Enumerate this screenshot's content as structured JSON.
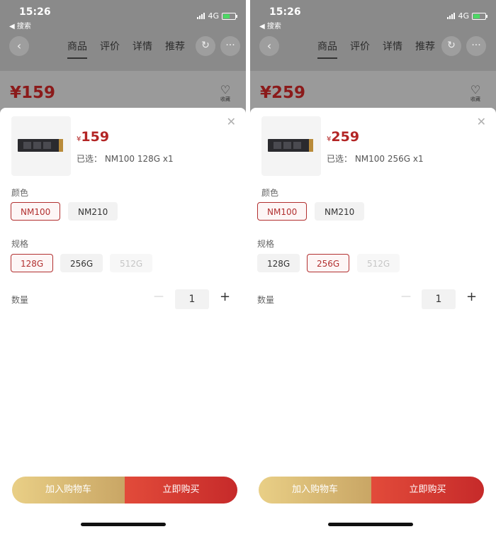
{
  "screens": [
    {
      "status": {
        "time": "15:26",
        "back_label": "◀ 搜索",
        "network": "4G"
      },
      "nav": {
        "back_icon": "chevron-left-icon",
        "tabs": [
          {
            "label": "商品"
          },
          {
            "label": "评价"
          },
          {
            "label": "详情"
          },
          {
            "label": "推荐"
          }
        ]
      },
      "background": {
        "price": "¥159",
        "favorite_label": "收藏"
      },
      "sheet": {
        "currency": "¥",
        "price": "159",
        "selected_text": "已选： NM100 128G x1",
        "color": {
          "label": "颜色",
          "options": [
            {
              "label": "NM100",
              "state": "selected"
            },
            {
              "label": "NM210",
              "state": "normal"
            }
          ]
        },
        "spec": {
          "label": "规格",
          "options": [
            {
              "label": "128G",
              "state": "selected"
            },
            {
              "label": "256G",
              "state": "normal"
            },
            {
              "label": "512G",
              "state": "disabled"
            }
          ]
        },
        "quantity": {
          "label": "数量",
          "minus": "—",
          "value": "1",
          "plus": "+"
        },
        "add_to_cart": "加入购物车",
        "buy_now": "立即购买"
      }
    },
    {
      "status": {
        "time": "15:26",
        "back_label": "◀ 搜索",
        "network": "4G"
      },
      "nav": {
        "back_icon": "chevron-left-icon",
        "tabs": [
          {
            "label": "商品"
          },
          {
            "label": "评价"
          },
          {
            "label": "详情"
          },
          {
            "label": "推荐"
          }
        ]
      },
      "background": {
        "price": "¥259",
        "favorite_label": "收藏"
      },
      "sheet": {
        "currency": "¥",
        "price": "259",
        "selected_text": "已选： NM100 256G x1",
        "color": {
          "label": "颜色",
          "options": [
            {
              "label": "NM100",
              "state": "selected"
            },
            {
              "label": "NM210",
              "state": "normal"
            }
          ]
        },
        "spec": {
          "label": "规格",
          "options": [
            {
              "label": "128G",
              "state": "normal"
            },
            {
              "label": "256G",
              "state": "selected"
            },
            {
              "label": "512G",
              "state": "disabled"
            }
          ]
        },
        "quantity": {
          "label": "数量",
          "minus": "—",
          "value": "1",
          "plus": "+"
        },
        "add_to_cart": "加入购物车",
        "buy_now": "立即购买"
      }
    }
  ],
  "colors": {
    "accent": "#b23030",
    "price": "#b32525",
    "cart_gold": "#d6b873",
    "buy_red": "#d63a31"
  }
}
